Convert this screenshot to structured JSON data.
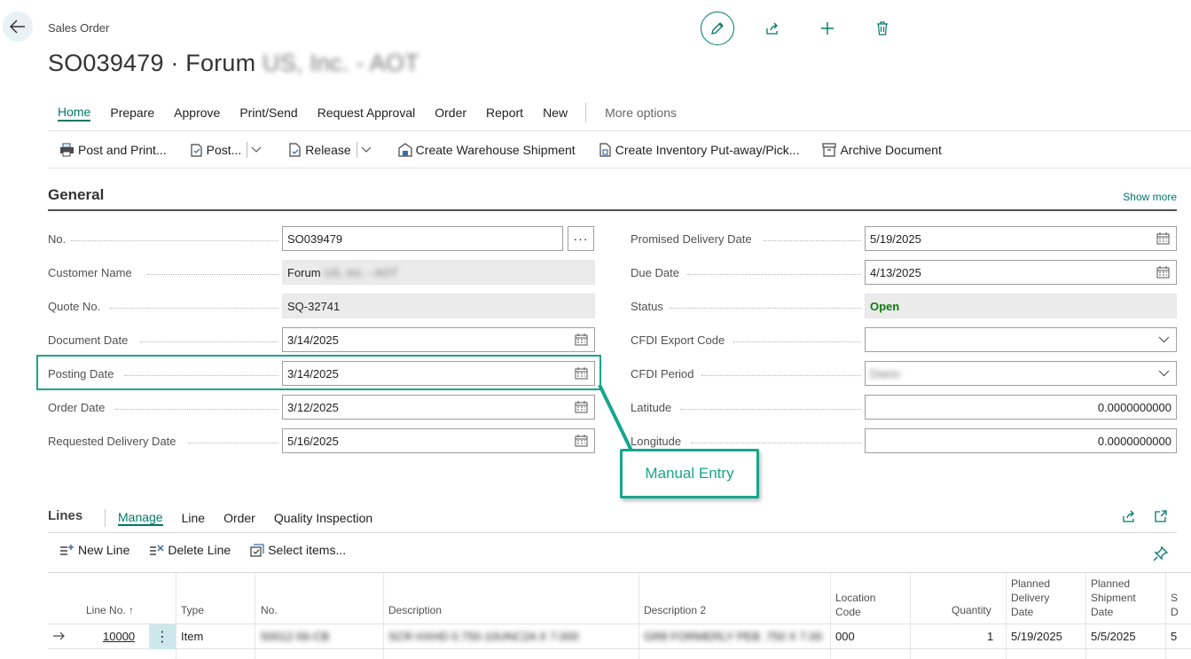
{
  "header": {
    "breadcrumb": "Sales Order",
    "title_prefix": "SO039479 · Forum",
    "title_blurred": "US, Inc. - AOT"
  },
  "top_actions": [
    "pencil-icon",
    "share-icon",
    "plus-icon",
    "trash-icon"
  ],
  "menu": {
    "items": [
      "Home",
      "Prepare",
      "Approve",
      "Print/Send",
      "Request Approval",
      "Order",
      "Report",
      "New"
    ],
    "more": "More options"
  },
  "actions": {
    "post_print": "Post and Print...",
    "post": "Post...",
    "release": "Release",
    "create_warehouse_shipment": "Create Warehouse Shipment",
    "create_inventory": "Create Inventory Put-away/Pick...",
    "archive": "Archive Document"
  },
  "general": {
    "title": "General",
    "show_more": "Show more",
    "left": {
      "no_label": "No.",
      "no_value": "SO039479",
      "customer_label": "Customer Name",
      "customer_value_prefix": "Forum",
      "customer_value_blurred": "US, Inc. - AOT",
      "quote_label": "Quote No.",
      "quote_value": "SQ-32741",
      "document_date_label": "Document Date",
      "document_date_value": "3/14/2025",
      "posting_date_label": "Posting Date",
      "posting_date_value": "3/14/2025",
      "order_date_label": "Order Date",
      "order_date_value": "3/12/2025",
      "requested_delivery_label": "Requested Delivery Date",
      "requested_delivery_value": "5/16/2025"
    },
    "right": {
      "promised_label": "Promised Delivery Date",
      "promised_value": "5/19/2025",
      "due_label": "Due Date",
      "due_value": "4/13/2025",
      "status_label": "Status",
      "status_value": "Open",
      "cfdi_export_label": "CFDI Export Code",
      "cfdi_export_value": "",
      "cfdi_period_label": "CFDI Period",
      "cfdi_period_value": "Diario",
      "latitude_label": "Latitude",
      "latitude_value": "0.0000000000",
      "longitude_label": "Longitude",
      "longitude_value": "0.0000000000"
    },
    "colors": {
      "accent": "#00796b",
      "callout": "#17a58d",
      "status_open": "#107c10"
    }
  },
  "callout": {
    "text": "Manual Entry"
  },
  "lines": {
    "title": "Lines",
    "tabs": [
      "Manage",
      "Line",
      "Order",
      "Quality Inspection"
    ],
    "actions": {
      "new_line": "New Line",
      "delete_line": "Delete Line",
      "select_items": "Select items..."
    },
    "columns": {
      "line_no": "Line No. ↑",
      "type": "Type",
      "no": "No.",
      "description": "Description",
      "description2": "Description 2",
      "location_code_1": "Location",
      "location_code_2": "Code",
      "quantity": "Quantity",
      "planned_delivery_1": "Planned",
      "planned_delivery_2": "Delivery",
      "planned_delivery_3": "Date",
      "planned_shipment_1": "Planned",
      "planned_shipment_2": "Shipment",
      "planned_shipment_3": "Date",
      "next_col_1": "S",
      "next_col_2": "D"
    },
    "rows": [
      {
        "line_no": "10000",
        "type": "Item",
        "no": "50012-56-CB",
        "description": "SCR HXHD 0.750-10UNC2A X 7.000",
        "description2": "GR8 FORMERLY PEB .750 X 7.00",
        "location": "000",
        "quantity": "1",
        "planned_delivery": "5/19/2025",
        "planned_shipment": "5/5/2025",
        "next": "5"
      }
    ]
  }
}
